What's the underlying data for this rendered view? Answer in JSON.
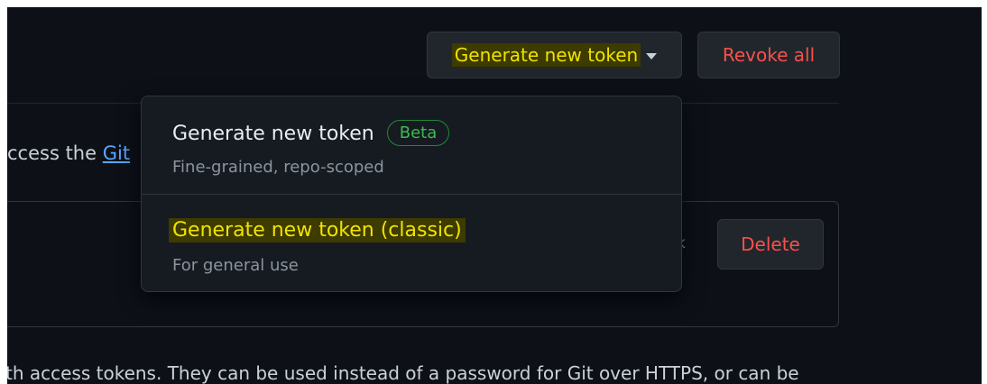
{
  "toolbar": {
    "generate_label": "Generate new token",
    "revoke_label": "Revoke all"
  },
  "intro": {
    "prefix": "ccess the ",
    "link": "Git"
  },
  "token": {
    "tail": "k",
    "delete_label": "Delete"
  },
  "footer": {
    "text": "th access tokens. They can be used instead of a password for Git over HTTPS, or can be"
  },
  "dropdown": {
    "items": [
      {
        "title": "Generate new token",
        "badge": "Beta",
        "description": "Fine-grained, repo-scoped"
      },
      {
        "title": "Generate new token (classic)",
        "description": "For general use"
      }
    ]
  },
  "colors": {
    "background": "#0d1117",
    "highlight": "#f0e300",
    "danger": "#f85149",
    "badge": "#3fb950",
    "link": "#58a6ff"
  },
  "icons": {
    "caret": "caret-down-icon"
  }
}
